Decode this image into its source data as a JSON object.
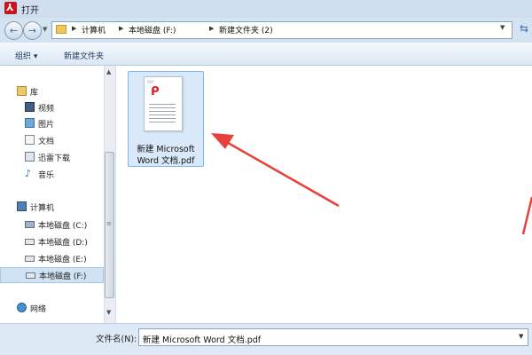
{
  "window": {
    "title": "打开",
    "app_icon": "adobe-acrobat-icon"
  },
  "address_bar": {
    "breadcrumbs": [
      "计算机",
      "本地磁盘 (F:)",
      "新建文件夹 (2)"
    ]
  },
  "toolbar": {
    "organize_label": "组织 ▾",
    "new_folder_label": "新建文件夹"
  },
  "sidebar": {
    "libraries": {
      "label": "库",
      "items": [
        {
          "label": "视频",
          "icon": "video-icon"
        },
        {
          "label": "图片",
          "icon": "picture-icon"
        },
        {
          "label": "文档",
          "icon": "document-icon"
        },
        {
          "label": "迅雷下载",
          "icon": "thunder-download-icon"
        },
        {
          "label": "音乐",
          "icon": "music-icon"
        }
      ]
    },
    "computer": {
      "label": "计算机",
      "items": [
        {
          "label": "本地磁盘 (C:)",
          "icon": "system-drive-icon"
        },
        {
          "label": "本地磁盘 (D:)",
          "icon": "drive-icon"
        },
        {
          "label": "本地磁盘 (E:)",
          "icon": "drive-icon"
        },
        {
          "label": "本地磁盘 (F:)",
          "icon": "drive-icon",
          "selected": true
        }
      ]
    },
    "network": {
      "label": "网络",
      "icon": "network-icon"
    }
  },
  "files": [
    {
      "name_line1": "新建 Microsoft",
      "name_line2": "Word 文档.pdf",
      "icon": "pdf-file-icon",
      "badge": "PDF",
      "selected": true
    }
  ],
  "bottom": {
    "filename_label": "文件名(N):",
    "filename_value": "新建 Microsoft Word 文档.pdf"
  },
  "colors": {
    "annotation_arrow": "#e8403a",
    "selection": "#d9e9f9",
    "pdf_red": "#d9232e"
  }
}
